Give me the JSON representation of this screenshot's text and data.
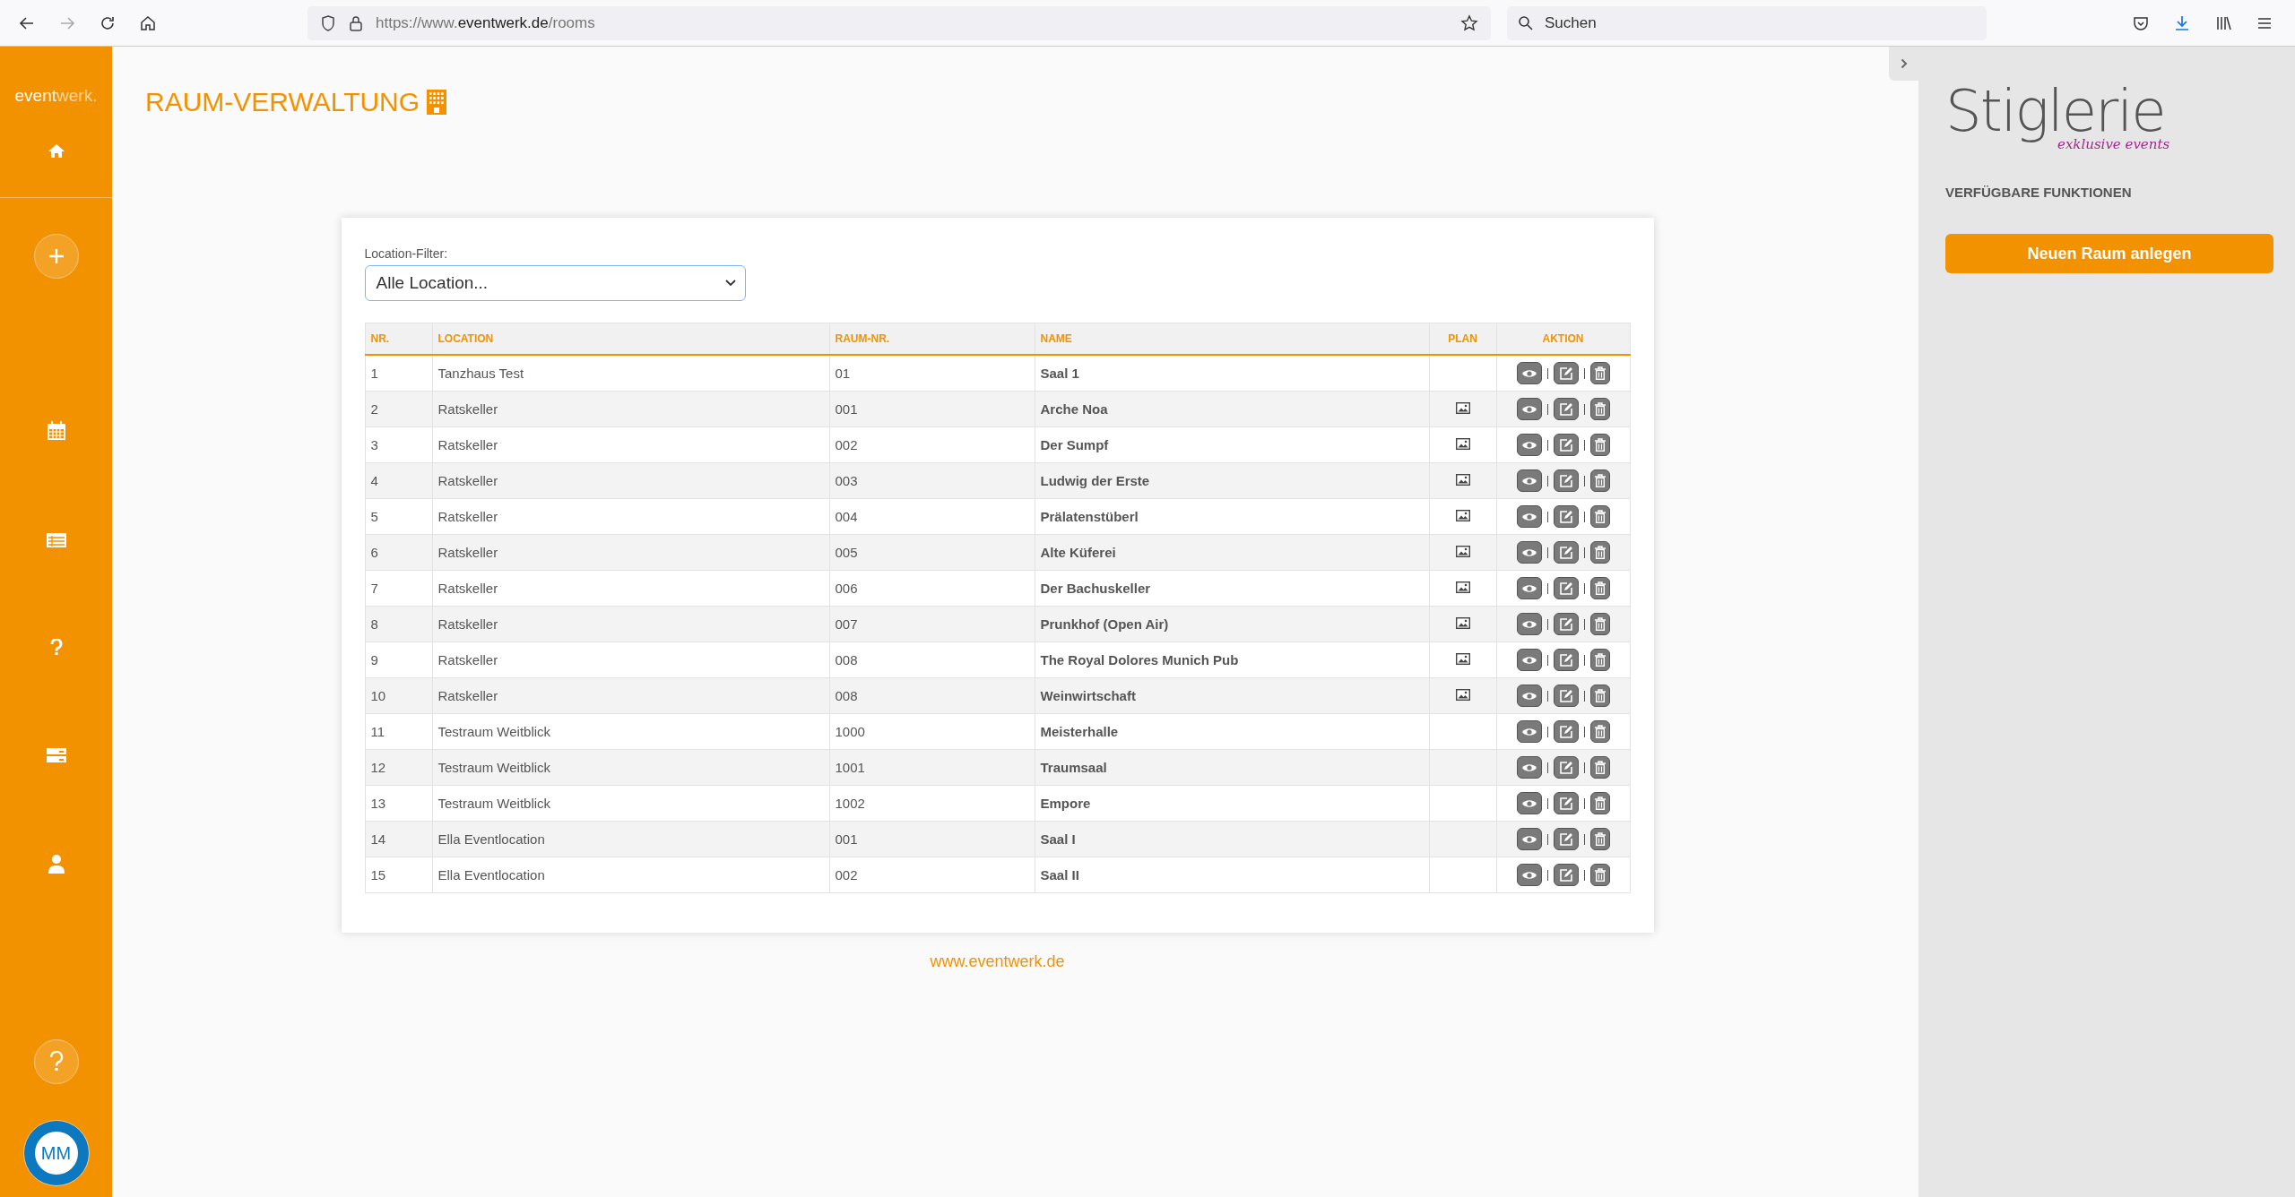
{
  "browser": {
    "url_host": "https://www.",
    "url_domain": "eventwerk.de",
    "url_path": "/rooms",
    "search_placeholder": "Suchen"
  },
  "sidebar": {
    "logo": [
      "event",
      "werk."
    ]
  },
  "avatar": {
    "text": "MM"
  },
  "page_title": "RAUM-VERWALTUNG",
  "filter": {
    "label": "Location-Filter:",
    "value": "Alle Location..."
  },
  "table": {
    "columns": [
      "NR.",
      "LOCATION",
      "RAUM-NR.",
      "NAME",
      "PLAN",
      "AKTION"
    ],
    "rows": [
      {
        "nr": "1",
        "location": "Tanzhaus Test",
        "room_no": "01",
        "name": "Saal 1",
        "plan": false
      },
      {
        "nr": "2",
        "location": "Ratskeller",
        "room_no": "001",
        "name": "Arche Noa",
        "plan": true
      },
      {
        "nr": "3",
        "location": "Ratskeller",
        "room_no": "002",
        "name": "Der Sumpf",
        "plan": true
      },
      {
        "nr": "4",
        "location": "Ratskeller",
        "room_no": "003",
        "name": "Ludwig der Erste",
        "plan": true
      },
      {
        "nr": "5",
        "location": "Ratskeller",
        "room_no": "004",
        "name": "Prälatenstüberl",
        "plan": true
      },
      {
        "nr": "6",
        "location": "Ratskeller",
        "room_no": "005",
        "name": "Alte Küferei",
        "plan": true
      },
      {
        "nr": "7",
        "location": "Ratskeller",
        "room_no": "006",
        "name": "Der Bachuskeller",
        "plan": true
      },
      {
        "nr": "8",
        "location": "Ratskeller",
        "room_no": "007",
        "name": "Prunkhof (Open Air)",
        "plan": true
      },
      {
        "nr": "9",
        "location": "Ratskeller",
        "room_no": "008",
        "name": "The Royal Dolores Munich Pub",
        "plan": true
      },
      {
        "nr": "10",
        "location": "Ratskeller",
        "room_no": "008",
        "name": "Weinwirtschaft",
        "plan": true
      },
      {
        "nr": "11",
        "location": "Testraum Weitblick",
        "room_no": "1000",
        "name": "Meisterhalle",
        "plan": false
      },
      {
        "nr": "12",
        "location": "Testraum Weitblick",
        "room_no": "1001",
        "name": "Traumsaal",
        "plan": false
      },
      {
        "nr": "13",
        "location": "Testraum Weitblick",
        "room_no": "1002",
        "name": "Empore",
        "plan": false
      },
      {
        "nr": "14",
        "location": "Ella Eventlocation",
        "room_no": "001",
        "name": "Saal I",
        "plan": false
      },
      {
        "nr": "15",
        "location": "Ella Eventlocation",
        "room_no": "002",
        "name": "Saal II",
        "plan": false
      }
    ]
  },
  "footer_link": "www.eventwerk.de",
  "right_panel": {
    "brand": "Stiglerie",
    "tagline": "exklusive events",
    "section_title": "VERFÜGBARE FUNKTIONEN",
    "button": "Neuen Raum anlegen"
  }
}
